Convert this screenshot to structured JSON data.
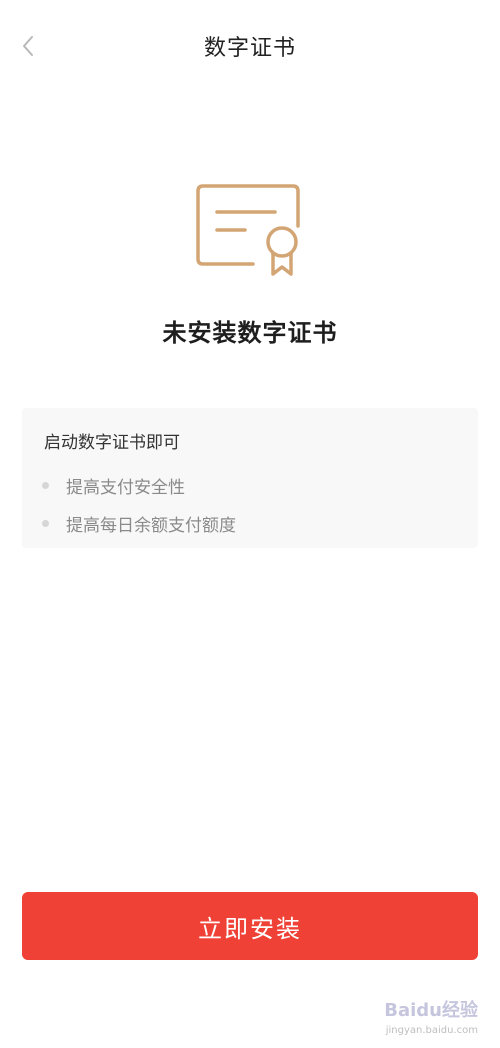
{
  "header": {
    "title": "数字证书",
    "back_icon": "chevron-left-icon"
  },
  "certificate": {
    "icon": "certificate-icon",
    "status_text": "未安装数字证书",
    "accent_color": "#d4a574"
  },
  "info": {
    "heading": "启动数字证书即可",
    "benefits": [
      "提高支付安全性",
      "提高每日余额支付额度"
    ]
  },
  "actions": {
    "install_label": "立即安装",
    "install_color": "#ef4136"
  },
  "watermark": {
    "brand": "Baidu经验",
    "url": "jingyan.baidu.com"
  }
}
